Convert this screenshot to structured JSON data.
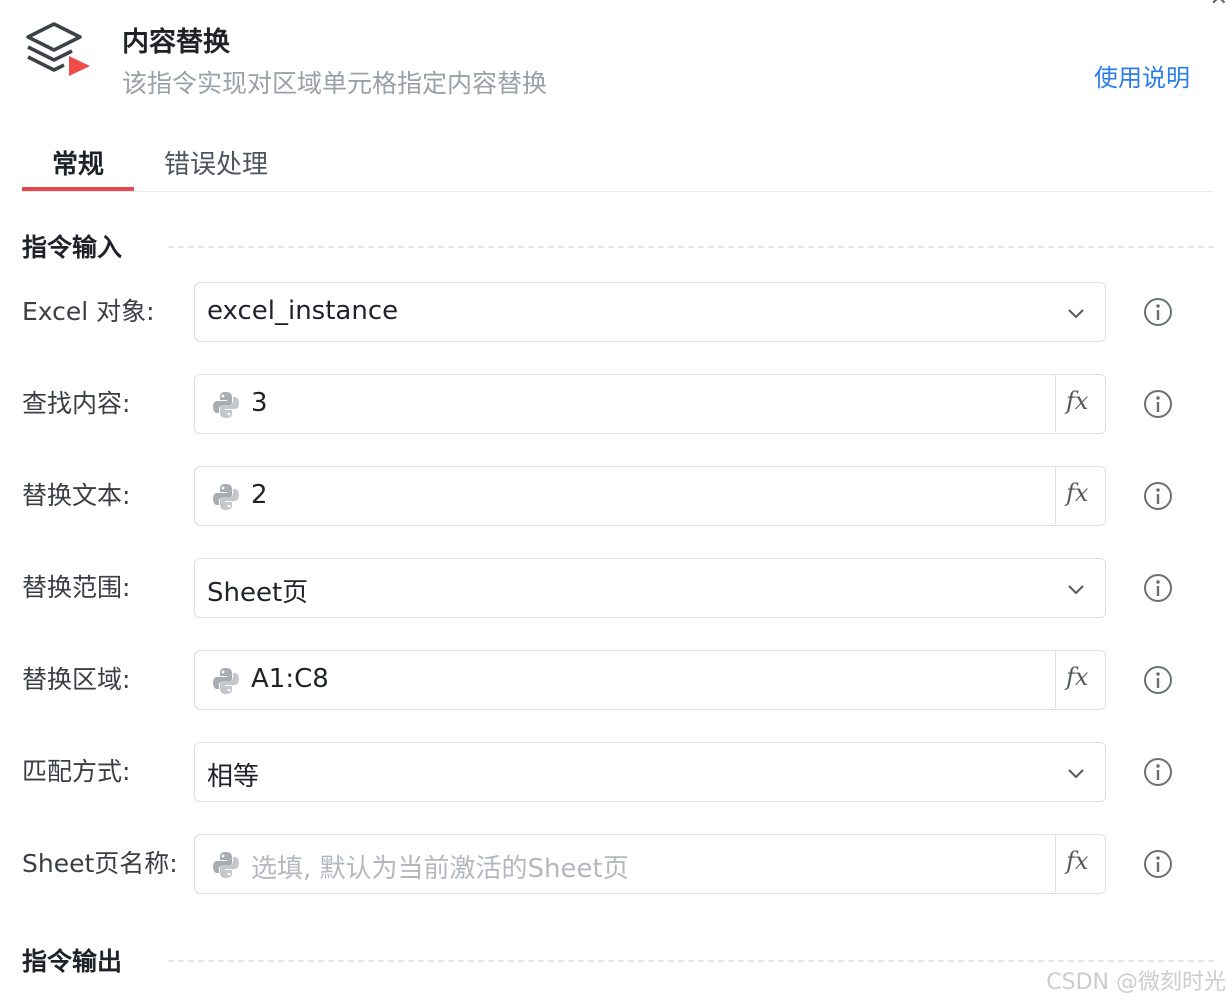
{
  "header": {
    "title": "内容替换",
    "subtitle": "该指令实现对区域单元格指定内容替换",
    "help_link": "使用说明",
    "icon": "layers-play-icon"
  },
  "tabs": [
    {
      "label": "常规",
      "active": true
    },
    {
      "label": "错误处理",
      "active": false
    }
  ],
  "sections": {
    "input_title": "指令输入",
    "output_title": "指令输出"
  },
  "fields": [
    {
      "label": "Excel 对象:",
      "type": "select",
      "value": "excel_instance"
    },
    {
      "label": "查找内容:",
      "type": "expression",
      "value": "3",
      "fx": "fx"
    },
    {
      "label": "替换文本:",
      "type": "expression",
      "value": "2",
      "fx": "fx"
    },
    {
      "label": "替换范围:",
      "type": "select",
      "value": "Sheet页"
    },
    {
      "label": "替换区域:",
      "type": "expression",
      "value": "A1:C8",
      "fx": "fx"
    },
    {
      "label": "匹配方式:",
      "type": "select",
      "value": "相等"
    },
    {
      "label": "Sheet页名称:",
      "type": "expression",
      "value": "",
      "placeholder": "选填, 默认为当前激活的Sheet页",
      "fx": "fx"
    }
  ],
  "watermark": "CSDN @微刻时光",
  "colors": {
    "accent": "#e5484d",
    "link": "#2b7de9",
    "border": "#dcdfe4"
  }
}
